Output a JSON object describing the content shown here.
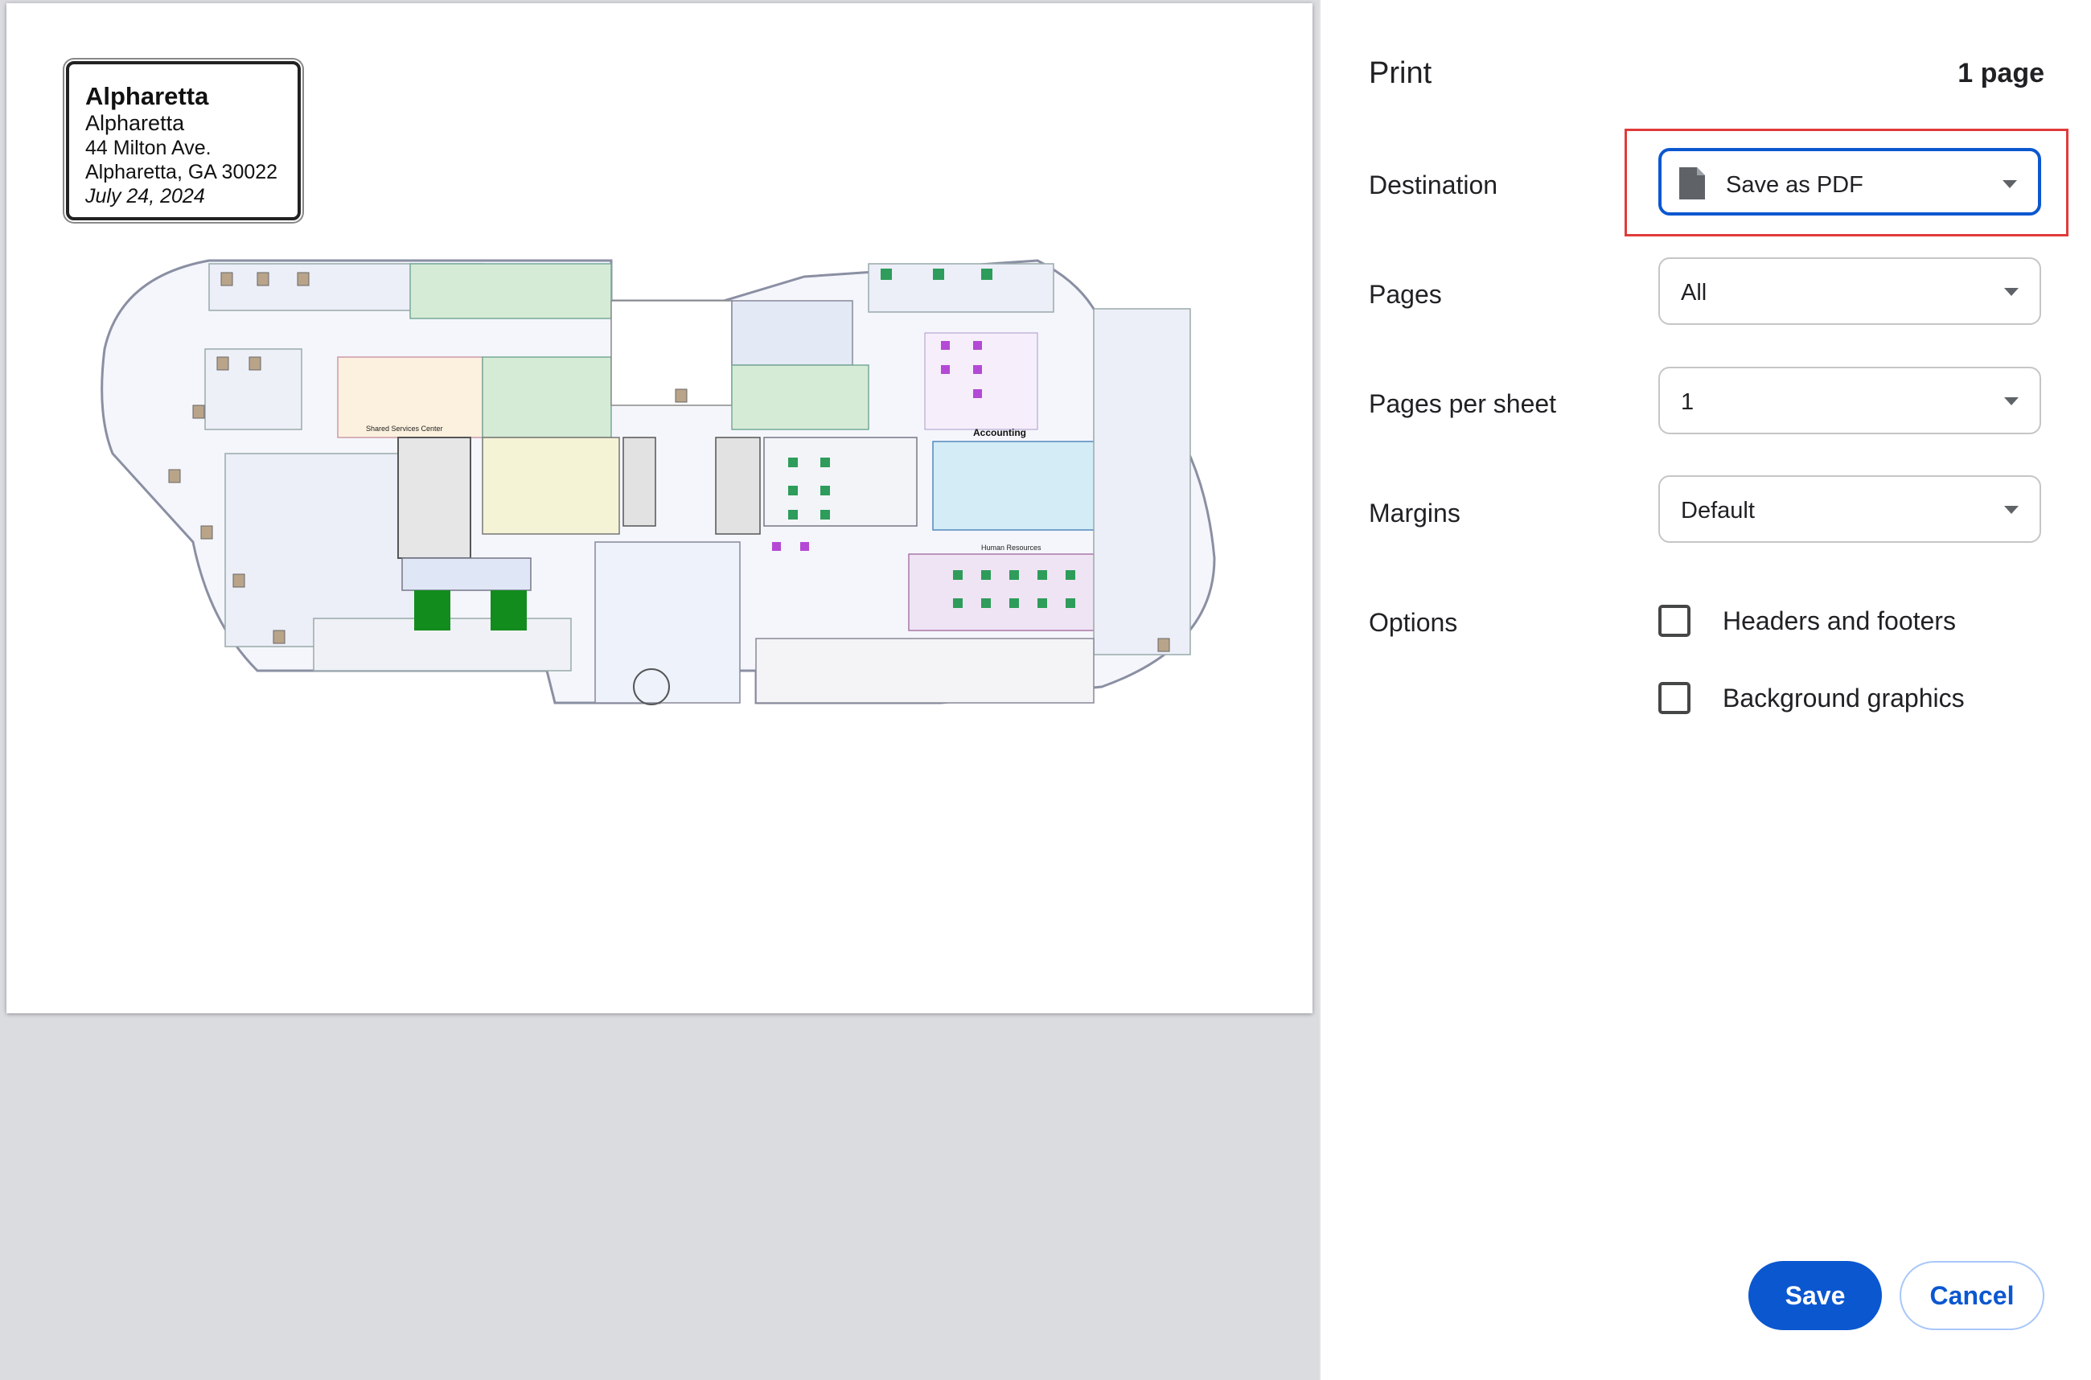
{
  "preview": {
    "info_box": {
      "title": "Alpharetta",
      "line1": "Alpharetta",
      "line2": "44 Milton Ave.",
      "line3": "Alpharetta, GA 30022",
      "date": "July 24, 2024"
    },
    "floorplan": {
      "labels": {
        "accounting": "Accounting",
        "human_resources": "Human Resources",
        "shared_services": "Shared Services Center"
      }
    }
  },
  "settings": {
    "title": "Print",
    "page_count": "1 page",
    "destination": {
      "label": "Destination",
      "value": "Save as PDF"
    },
    "pages": {
      "label": "Pages",
      "value": "All"
    },
    "pages_per_sheet": {
      "label": "Pages per sheet",
      "value": "1"
    },
    "margins": {
      "label": "Margins",
      "value": "Default"
    },
    "options": {
      "label": "Options",
      "headers_footers": {
        "label": "Headers and footers",
        "checked": false
      },
      "background_graphics": {
        "label": "Background graphics",
        "checked": false
      }
    },
    "buttons": {
      "save": "Save",
      "cancel": "Cancel"
    }
  },
  "colors": {
    "accent": "#0b57d0",
    "highlight": "#e03b3b",
    "preview_bg": "#dadce0"
  }
}
